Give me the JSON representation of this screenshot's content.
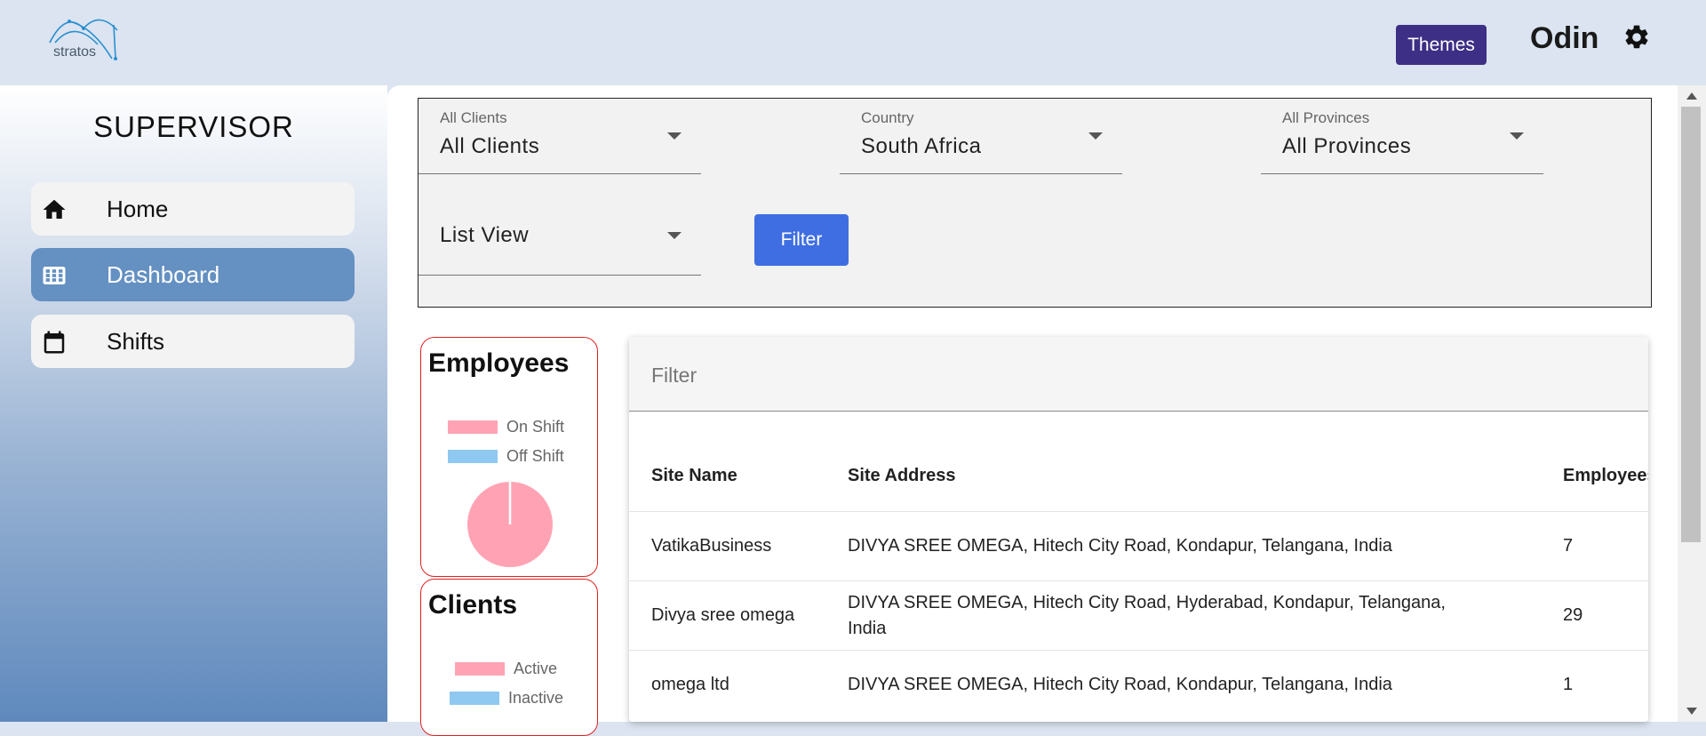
{
  "app": {
    "logo_text": "stratos",
    "themes_label": "Themes",
    "user_name": "Odin",
    "icons": {
      "settings": "gear-icon"
    }
  },
  "sidebar": {
    "role": "SUPERVISOR",
    "items": [
      {
        "label": "Home",
        "icon": "home-icon",
        "active": false
      },
      {
        "label": "Dashboard",
        "icon": "grid-icon",
        "active": true
      },
      {
        "label": "Shifts",
        "icon": "calendar-icon",
        "active": false
      }
    ]
  },
  "filters": {
    "client": {
      "label": "All Clients",
      "value": "All Clients"
    },
    "country": {
      "label": "Country",
      "value": "South Africa"
    },
    "province": {
      "label": "All Provinces",
      "value": "All Provinces"
    },
    "view": {
      "value": "List View"
    },
    "filter_button": "Filter"
  },
  "employees_card": {
    "title": "Employees",
    "legend": [
      "On Shift",
      "Off Shift"
    ],
    "on_shift_fraction": 0.99,
    "colors": {
      "on": "#ffa3b4",
      "off": "#8fc8f0"
    }
  },
  "clients_card": {
    "title": "Clients",
    "legend": [
      "Active",
      "Inactive"
    ]
  },
  "table": {
    "filter_placeholder": "Filter",
    "headers": [
      "Site Name",
      "Site Address",
      "Employees"
    ],
    "rows": [
      {
        "name": "VatikaBusiness",
        "address": "DIVYA SREE OMEGA, Hitech City Road, Kondapur, Telangana, India",
        "employees": "7"
      },
      {
        "name": "Divya sree omega",
        "address": "DIVYA SREE OMEGA, Hitech City Road, Hyderabad, Kondapur, Telangana, India",
        "employees": "29"
      },
      {
        "name": "omega ltd",
        "address": "DIVYA SREE OMEGA, Hitech City Road, Kondapur, Telangana, India",
        "employees": "1"
      }
    ]
  }
}
